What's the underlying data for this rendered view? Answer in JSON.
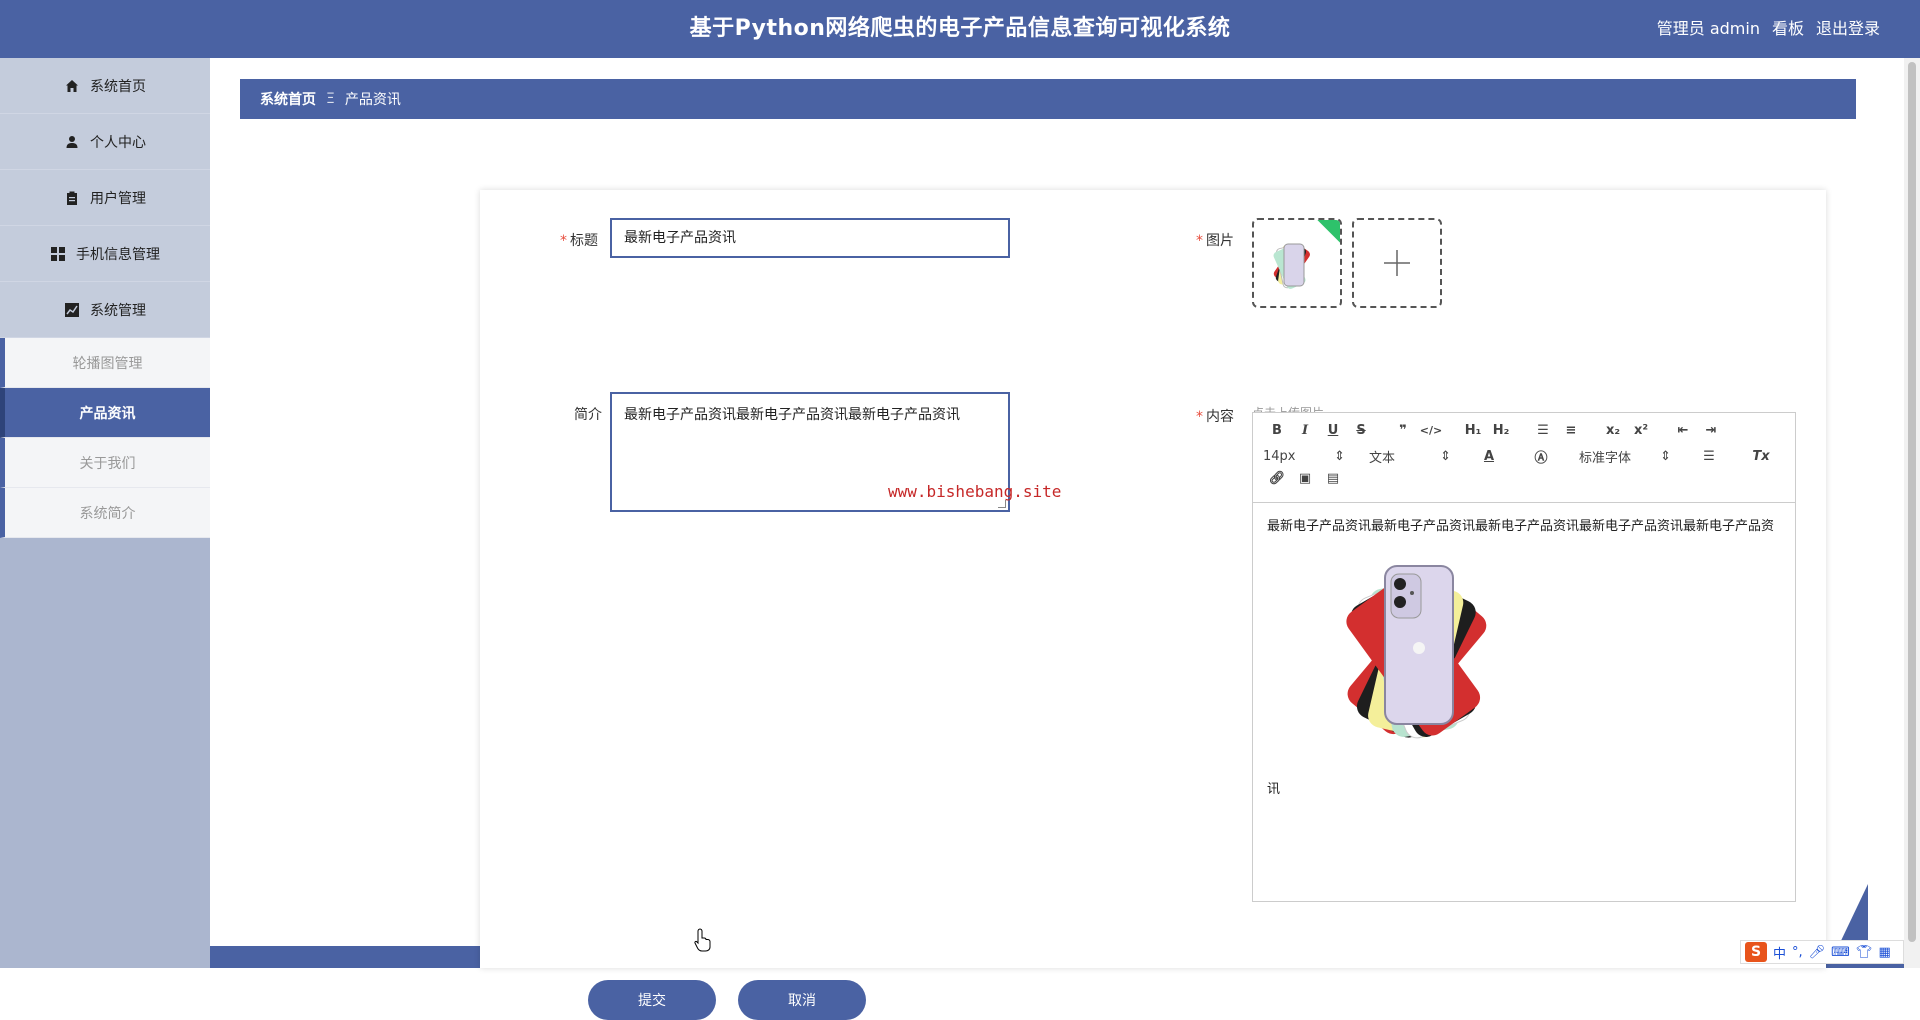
{
  "header": {
    "title": "基于Python网络爬虫的电子产品信息查询可视化系统",
    "user_label": "管理员 admin",
    "board_link": "看板",
    "logout_link": "退出登录"
  },
  "sidebar": {
    "items": [
      {
        "label": "系统首页",
        "icon": "home-icon"
      },
      {
        "label": "个人中心",
        "icon": "user-icon"
      },
      {
        "label": "用户管理",
        "icon": "clipboard-icon"
      },
      {
        "label": "手机信息管理",
        "icon": "grid-icon"
      },
      {
        "label": "系统管理",
        "icon": "chart-icon"
      }
    ],
    "sub_items": [
      {
        "label": "轮播图管理"
      },
      {
        "label": "产品资讯"
      },
      {
        "label": "关于我们"
      },
      {
        "label": "系统简介"
      }
    ]
  },
  "breadcrumb": {
    "home": "系统首页",
    "separator": "Ξ",
    "current": "产品资讯"
  },
  "form": {
    "title_label": "标题",
    "title_value": "最新电子产品资讯",
    "summary_label": "简介",
    "summary_value": "最新电子产品资讯最新电子产品资讯最新电子产品资讯",
    "image_label": "图片",
    "upload_hint": "点击上传图片",
    "content_label": "内容",
    "submit_label": "提交",
    "cancel_label": "取消"
  },
  "editor": {
    "font_size": "14px",
    "text_style": "文本",
    "font_family": "标准字体",
    "content_text": "最新电子产品资讯最新电子产品资讯最新电子产品资讯最新电子产品资讯最新电子产品资",
    "content_tail": "讯"
  },
  "watermark": "www.bishebang.site",
  "ime": {
    "lang": "中",
    "punct": "°,"
  },
  "colors": {
    "primary": "#4a62a3",
    "required": "#e74c3c",
    "watermark": "#c62828"
  }
}
